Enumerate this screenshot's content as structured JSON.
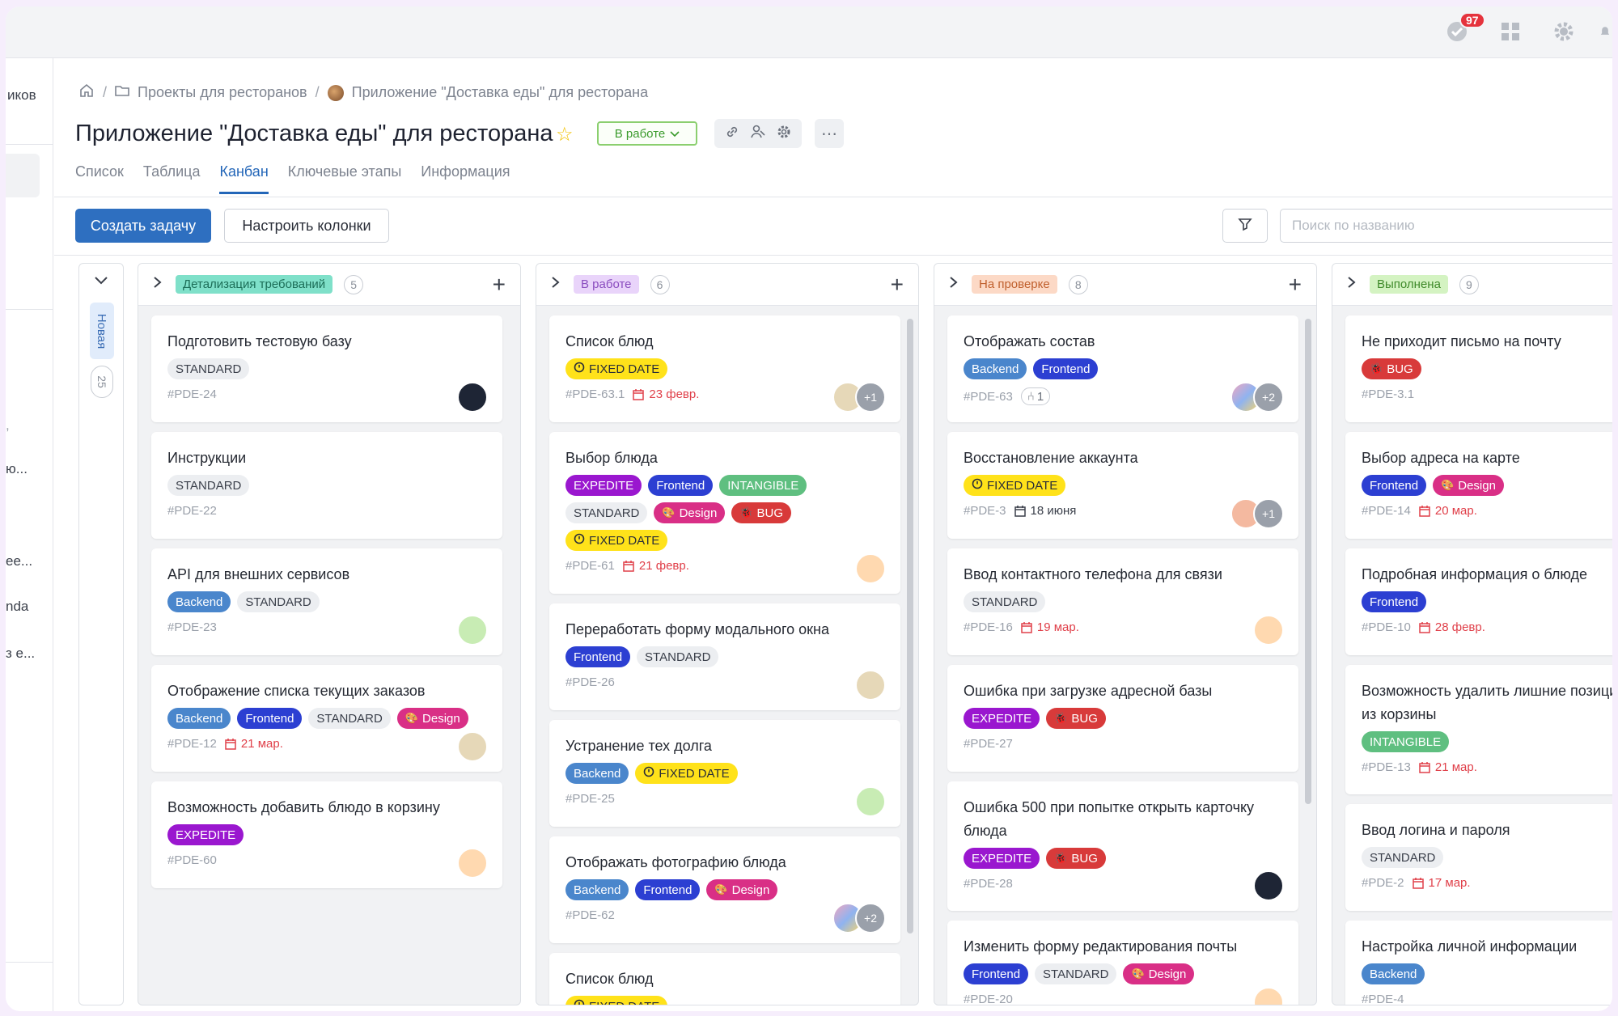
{
  "topbar": {
    "notifications_count": "97"
  },
  "leftnav": {
    "fragments": [
      "иков",
      "ю...",
      "ee...",
      "nda",
      "з е..."
    ]
  },
  "breadcrumb": {
    "items": [
      "Проекты для ресторанов",
      "Приложение \"Доставка еды\" для ресторана"
    ]
  },
  "project": {
    "title": "Приложение \"Доставка еды\" для ресторана",
    "status": "В работе"
  },
  "tabs": [
    "Список",
    "Таблица",
    "Канбан",
    "Ключевые этапы",
    "Информация"
  ],
  "toolbar": {
    "create_label": "Создать задачу",
    "columns_label": "Настроить колонки",
    "search_placeholder": "Поиск по названию"
  },
  "collapsed_column": {
    "label": "Новая",
    "count": "25"
  },
  "columns": [
    {
      "status": "Детализация требований",
      "count": "5",
      "bg": "#7fe0c9",
      "fg": "#1c6e58",
      "cards": [
        {
          "title": "Подготовить тестовую базу",
          "tags": [
            {
              "type": "standard",
              "label": "STANDARD"
            }
          ],
          "id": "#PDE-24",
          "date": "",
          "avatars": [
            "hood"
          ]
        },
        {
          "title": "Инструкции",
          "tags": [
            {
              "type": "standard",
              "label": "STANDARD"
            }
          ],
          "id": "#PDE-22",
          "date": "",
          "avatars": []
        },
        {
          "title": "API для внешних сервисов",
          "tags": [
            {
              "type": "backend",
              "label": "Backend"
            },
            {
              "type": "standard",
              "label": "STANDARD"
            }
          ],
          "id": "#PDE-23",
          "date": "",
          "avatars": [
            "green"
          ]
        },
        {
          "title": "Отображение списка текущих заказов",
          "tags": [
            {
              "type": "backend",
              "label": "Backend"
            },
            {
              "type": "frontend",
              "label": "Frontend"
            },
            {
              "type": "standard",
              "label": "STANDARD"
            },
            {
              "type": "design",
              "label": "Design"
            }
          ],
          "id": "#PDE-12",
          "date": "21 мар.",
          "avatars": [
            "man"
          ]
        },
        {
          "title": "Возможность добавить блюдо в корзину",
          "tags": [
            {
              "type": "expedite",
              "label": "EXPEDITE"
            }
          ],
          "id": "#PDE-60",
          "date": "",
          "avatars": [
            "girl"
          ]
        }
      ]
    },
    {
      "status": "В работе",
      "count": "6",
      "bg": "#e9d4fa",
      "fg": "#8a4cbf",
      "cards": [
        {
          "title": "Список блюд",
          "tags": [
            {
              "type": "fixed",
              "label": "FIXED DATE"
            }
          ],
          "id": "#PDE-63.1",
          "date": "23 февр.",
          "avatars": [
            "man",
            "+1"
          ]
        },
        {
          "title": "Выбор блюда",
          "tags": [
            {
              "type": "expedite",
              "label": "EXPEDITE"
            },
            {
              "type": "frontend",
              "label": "Frontend"
            },
            {
              "type": "intangible",
              "label": "INTANGIBLE"
            },
            {
              "type": "standard",
              "label": "STANDARD"
            },
            {
              "type": "design",
              "label": "Design"
            },
            {
              "type": "bug",
              "label": "BUG"
            },
            {
              "type": "fixed",
              "label": "FIXED DATE"
            }
          ],
          "id": "#PDE-61",
          "date": "21 февр.",
          "avatars": [
            "girl"
          ]
        },
        {
          "title": "Переработать форму модального окна",
          "tags": [
            {
              "type": "frontend",
              "label": "Frontend"
            },
            {
              "type": "standard",
              "label": "STANDARD"
            }
          ],
          "id": "#PDE-26",
          "date": "",
          "avatars": [
            "man"
          ]
        },
        {
          "title": "Устранение тех долга",
          "tags": [
            {
              "type": "backend",
              "label": "Backend"
            },
            {
              "type": "fixed",
              "label": "FIXED DATE"
            }
          ],
          "id": "#PDE-25",
          "date": "",
          "avatars": [
            "green"
          ]
        },
        {
          "title": "Отображать фотографию блюда",
          "tags": [
            {
              "type": "backend",
              "label": "Backend"
            },
            {
              "type": "frontend",
              "label": "Frontend"
            },
            {
              "type": "design",
              "label": "Design"
            }
          ],
          "id": "#PDE-62",
          "date": "",
          "avatars": [
            "multi",
            "+2"
          ]
        },
        {
          "title": "Список блюд",
          "tags": [
            {
              "type": "fixed",
              "label": "FIXED DATE"
            }
          ],
          "id": "",
          "date": "",
          "avatars": []
        }
      ]
    },
    {
      "status": "На проверке",
      "count": "8",
      "bg": "#fcd9c6",
      "fg": "#c0602e",
      "cards": [
        {
          "title": "Отображать состав",
          "tags": [
            {
              "type": "backend",
              "label": "Backend"
            },
            {
              "type": "frontend",
              "label": "Frontend"
            }
          ],
          "id": "#PDE-63",
          "subtasks": "1",
          "date": "",
          "avatars": [
            "multi",
            "+2"
          ]
        },
        {
          "title": "Восстановление аккаунта",
          "tags": [
            {
              "type": "fixed",
              "label": "FIXED DATE"
            }
          ],
          "id": "#PDE-3",
          "date": "18 июня",
          "date_dark": true,
          "avatars": [
            "girl2",
            "+1"
          ]
        },
        {
          "title": "Ввод контактного телефона для связи",
          "tags": [
            {
              "type": "standard",
              "label": "STANDARD"
            }
          ],
          "id": "#PDE-16",
          "date": "19 мар.",
          "avatars": [
            "girl"
          ]
        },
        {
          "title": "Ошибка при загрузке адресной базы",
          "tags": [
            {
              "type": "expedite",
              "label": "EXPEDITE"
            },
            {
              "type": "bug",
              "label": "BUG"
            }
          ],
          "id": "#PDE-27",
          "date": "",
          "avatars": []
        },
        {
          "title": "Ошибка 500 при попытке открыть карточку блюда",
          "tags": [
            {
              "type": "expedite",
              "label": "EXPEDITE"
            },
            {
              "type": "bug",
              "label": "BUG"
            }
          ],
          "id": "#PDE-28",
          "date": "",
          "avatars": [
            "hood"
          ]
        },
        {
          "title": "Изменить форму редактирования почты",
          "tags": [
            {
              "type": "frontend",
              "label": "Frontend"
            },
            {
              "type": "standard",
              "label": "STANDARD"
            },
            {
              "type": "design",
              "label": "Design"
            }
          ],
          "id": "#PDE-20",
          "date": "",
          "avatars": [
            "girl"
          ]
        }
      ]
    },
    {
      "status": "Выполнена",
      "count": "9",
      "bg": "#d4f3c2",
      "fg": "#3f8a2a",
      "cards": [
        {
          "title": "Не приходит письмо на почту",
          "tags": [
            {
              "type": "bug",
              "label": "BUG"
            }
          ],
          "id": "#PDE-3.1",
          "date": "",
          "avatars": []
        },
        {
          "title": "Выбор адреса на карте",
          "tags": [
            {
              "type": "frontend",
              "label": "Frontend"
            },
            {
              "type": "design",
              "label": "Design"
            }
          ],
          "id": "#PDE-14",
          "date": "20 мар.",
          "avatars": []
        },
        {
          "title": "Подробная информация о блюде",
          "tags": [
            {
              "type": "frontend",
              "label": "Frontend"
            }
          ],
          "id": "#PDE-10",
          "date": "28 февр.",
          "avatars": []
        },
        {
          "title": "Возможность удалить лишние позиции из корзины",
          "tags": [
            {
              "type": "intangible",
              "label": "INTANGIBLE"
            }
          ],
          "id": "#PDE-13",
          "date": "21 мар.",
          "avatars": []
        },
        {
          "title": "Ввод логина и пароля",
          "tags": [
            {
              "type": "standard",
              "label": "STANDARD"
            }
          ],
          "id": "#PDE-2",
          "date": "17 мар.",
          "avatars": []
        },
        {
          "title": "Настройка личной информации",
          "tags": [
            {
              "type": "backend",
              "label": "Backend"
            }
          ],
          "id": "#PDE-4",
          "date": "",
          "avatars": []
        }
      ]
    }
  ]
}
